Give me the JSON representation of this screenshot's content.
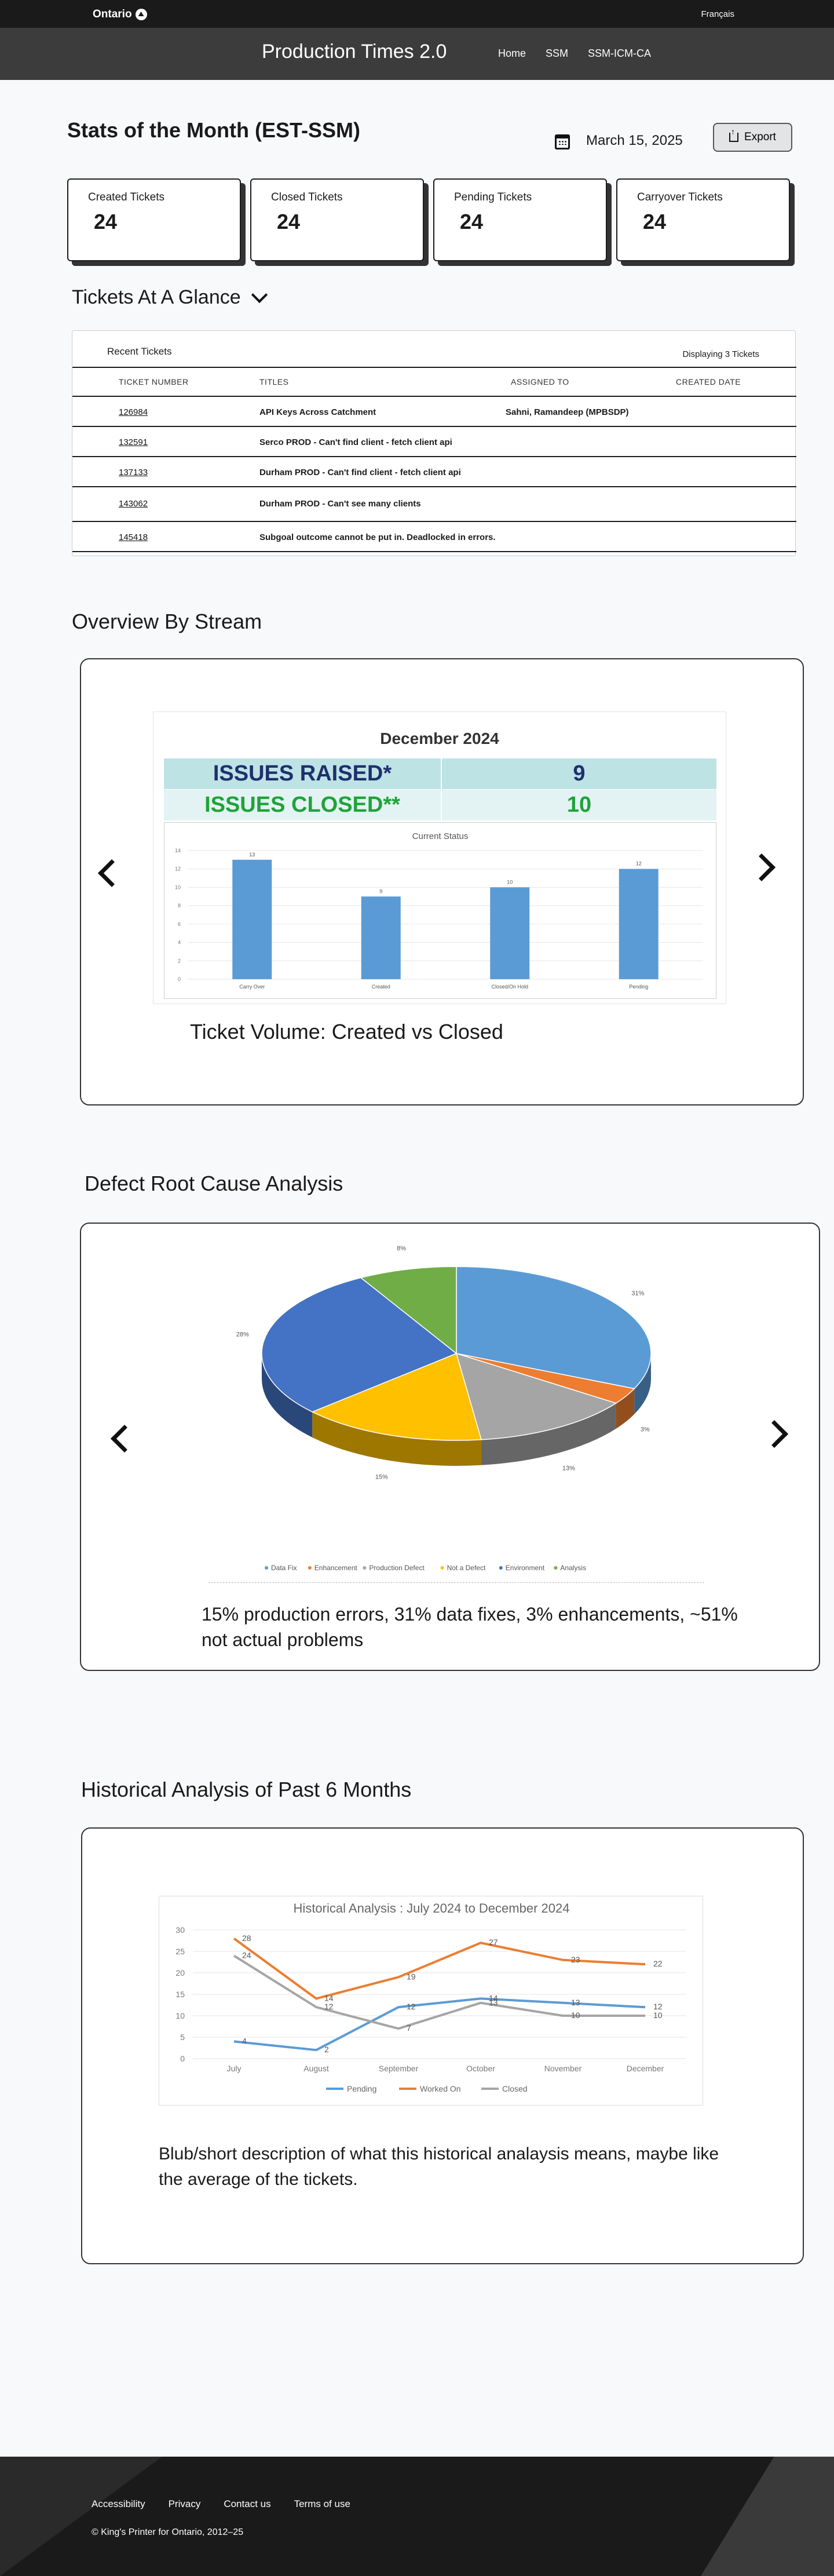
{
  "topbar": {
    "logo": "Ontario",
    "language": "Français"
  },
  "header": {
    "title": "Production Times 2.0",
    "nav": [
      "Home",
      "SSM",
      "SSM-ICM-CA"
    ]
  },
  "stats": {
    "title": "Stats of the Month (EST-SSM)",
    "date": "March 15, 2025",
    "export_label": "Export",
    "cards": [
      {
        "label": "Created Tickets",
        "value": "24"
      },
      {
        "label": "Closed Tickets",
        "value": "24"
      },
      {
        "label": "Pending Tickets",
        "value": "24"
      },
      {
        "label": "Carryover Tickets",
        "value": "24"
      }
    ]
  },
  "glance": {
    "title": "Tickets At A Glance",
    "recent_label": "Recent Tickets",
    "displaying": "Displaying 3 Tickets",
    "columns": [
      "TICKET NUMBER",
      "TITLES",
      "ASSIGNED TO",
      "CREATED DATE"
    ],
    "rows": [
      {
        "number": "126984",
        "title": "API Keys Across Catchment",
        "assigned": "Sahni, Ramandeep (MPBSDP)"
      },
      {
        "number": "132591",
        "title": "Serco PROD - Can't find client - fetch client api",
        "assigned": ""
      },
      {
        "number": "137133",
        "title": "Durham PROD - Can't find client - fetch client api",
        "assigned": ""
      },
      {
        "number": "143062",
        "title": "Durham PROD - Can't see many clients",
        "assigned": ""
      },
      {
        "number": "145418",
        "title": "Subgoal outcome cannot be put in. Deadlocked in errors.",
        "assigned": ""
      }
    ]
  },
  "stream": {
    "title": "Overview By Stream",
    "month": "December 2024",
    "issues_raised_label": "ISSUES RAISED*",
    "issues_raised_value": "9",
    "issues_closed_label": "ISSUES CLOSED**",
    "issues_closed_value": "10",
    "caption": "Ticket Volume: Created vs Closed",
    "colors": {
      "raised": "#1f2f6e",
      "closed": "#1fa33a",
      "bar": "#5b9bd5"
    }
  },
  "defect": {
    "title": "Defect Root Cause Analysis",
    "caption": "15% production errors, 31% data fixes, 3% enhancements, ~51% not actual problems"
  },
  "historical": {
    "title": "Historical Analysis of Past 6 Months",
    "caption": "Blub/short description of what this historical analaysis means, maybe like the average of the tickets."
  },
  "footer": {
    "links": [
      "Accessibility",
      "Privacy",
      "Contact us",
      "Terms of use"
    ],
    "copyright": "© King's Printer for Ontario, 2012–25"
  },
  "chart_data": [
    {
      "type": "bar",
      "title": "Current Status",
      "categories": [
        "Carry Over",
        "Created",
        "Closed/On Hold",
        "Pending"
      ],
      "values": [
        13,
        9,
        10,
        12
      ],
      "ylim": [
        0,
        14
      ]
    },
    {
      "type": "pie",
      "categories": [
        "Data Fix",
        "Enhancement",
        "Production Defect",
        "Not a Defect",
        "Environment",
        "Analysis"
      ],
      "values": [
        31,
        3,
        13,
        15,
        28,
        8
      ],
      "colors": [
        "#5b9bd5",
        "#ed7d31",
        "#a5a5a5",
        "#ffc000",
        "#4472c4",
        "#70ad47"
      ]
    },
    {
      "type": "line",
      "title": "Historical Analysis : July 2024 to December 2024",
      "x": [
        "July",
        "August",
        "September",
        "October",
        "November",
        "December"
      ],
      "series": [
        {
          "name": "Pending",
          "values": [
            4,
            2,
            12,
            14,
            13,
            12
          ],
          "color": "#5b9bd5"
        },
        {
          "name": "Worked On",
          "values": [
            28,
            14,
            19,
            27,
            23,
            22
          ],
          "color": "#ed7d31"
        },
        {
          "name": "Closed",
          "values": [
            24,
            12,
            7,
            13,
            10,
            10
          ],
          "color": "#a5a5a5"
        }
      ],
      "ylim": [
        0,
        30
      ]
    }
  ]
}
